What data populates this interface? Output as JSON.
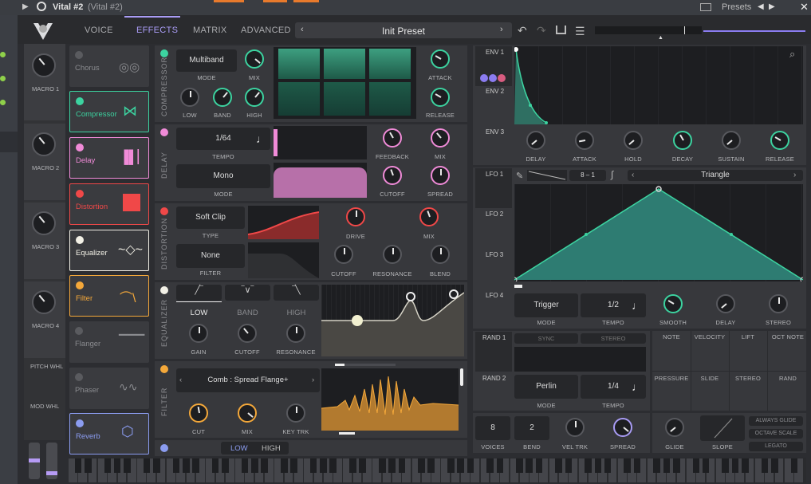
{
  "window": {
    "title": "Vital #2",
    "subtitle": "(Vital #2)",
    "presets_label": "Presets"
  },
  "tabs": [
    "VOICE",
    "EFFECTS",
    "MATRIX",
    "ADVANCED"
  ],
  "preset": "Init Preset",
  "macros": [
    "MACRO 1",
    "MACRO 2",
    "MACRO 3",
    "MACRO 4"
  ],
  "wheels": [
    "PITCH WHL",
    "MOD WHL"
  ],
  "effects": [
    {
      "name": "Chorus",
      "color": "#8a8b8f",
      "enabled": false
    },
    {
      "name": "Compressor",
      "color": "#3cd3a0",
      "enabled": true
    },
    {
      "name": "Delay",
      "color": "#f08bd8",
      "enabled": true
    },
    {
      "name": "Distortion",
      "color": "#f04848",
      "enabled": true
    },
    {
      "name": "Equalizer",
      "color": "#f2f0e6",
      "enabled": true
    },
    {
      "name": "Filter",
      "color": "#f4a83a",
      "enabled": true
    },
    {
      "name": "Flanger",
      "color": "#8a8b8f",
      "enabled": false
    },
    {
      "name": "Phaser",
      "color": "#8a8b8f",
      "enabled": false
    },
    {
      "name": "Reverb",
      "color": "#8b9cf0",
      "enabled": true
    }
  ],
  "compressor": {
    "title": "COMPRESSOR",
    "mode_value": "Multiband",
    "mode": "MODE",
    "mix": "MIX",
    "low": "LOW",
    "band": "BAND",
    "high": "HIGH",
    "attack": "ATTACK",
    "release": "RELEASE"
  },
  "delay": {
    "title": "DELAY",
    "tempo_value": "1/64",
    "tempo": "TEMPO",
    "mode_value": "Mono",
    "mode": "MODE",
    "feedback": "FEEDBACK",
    "mix": "MIX",
    "cutoff": "CUTOFF",
    "spread": "SPREAD"
  },
  "distortion": {
    "title": "DISTORTION",
    "type_value": "Soft Clip",
    "type": "TYPE",
    "filter_value": "None",
    "filter": "FILTER",
    "drive": "DRIVE",
    "mix": "MIX",
    "cutoff": "CUTOFF",
    "resonance": "RESONANCE",
    "blend": "BLEND"
  },
  "equalizer": {
    "title": "EQUALIZER",
    "low": "LOW",
    "band": "BAND",
    "high": "HIGH",
    "gain": "GAIN",
    "cutoff": "CUTOFF",
    "resonance": "RESONANCE"
  },
  "filter": {
    "title": "FILTER",
    "model": "Comb : Spread Flange+",
    "cut": "CUT",
    "mix": "MIX",
    "keytrk": "KEY TRK"
  },
  "reverb_bar": {
    "low": "LOW",
    "high": "HIGH"
  },
  "env": {
    "tabs": [
      "ENV 1",
      "ENV 2",
      "ENV 3"
    ],
    "knobs": [
      "DELAY",
      "ATTACK",
      "HOLD",
      "DECAY",
      "SUSTAIN",
      "RELEASE"
    ]
  },
  "lfo": {
    "tabs": [
      "LFO 1",
      "LFO 2",
      "LFO 3",
      "LFO 4"
    ],
    "grid_a": "8",
    "grid_b": "1",
    "shape": "Triangle",
    "mode_value": "Trigger",
    "mode": "MODE",
    "tempo_value": "1/2",
    "tempo": "TEMPO",
    "smooth": "SMOOTH",
    "delay": "DELAY",
    "stereo": "STEREO"
  },
  "rand": {
    "tabs": [
      "RAND 1",
      "RAND 2"
    ],
    "sync": "SYNC",
    "stereo": "STEREO",
    "mode_value": "Perlin",
    "mode": "MODE",
    "tempo_value": "1/4",
    "tempo": "TEMPO"
  },
  "mod_sources": [
    "NOTE",
    "VELOCITY",
    "LIFT",
    "OCT NOTE",
    "PRESSURE",
    "SLIDE",
    "STEREO",
    "RAND"
  ],
  "voice": {
    "voices_value": "8",
    "voices": "VOICES",
    "bend_value": "2",
    "bend": "BEND",
    "veltrk": "VEL TRK",
    "spread": "SPREAD",
    "glide": "GLIDE",
    "slope": "SLOPE",
    "always_glide": "ALWAYS GLIDE",
    "octave_scale": "OCTAVE SCALE",
    "legato": "LEGATO"
  }
}
